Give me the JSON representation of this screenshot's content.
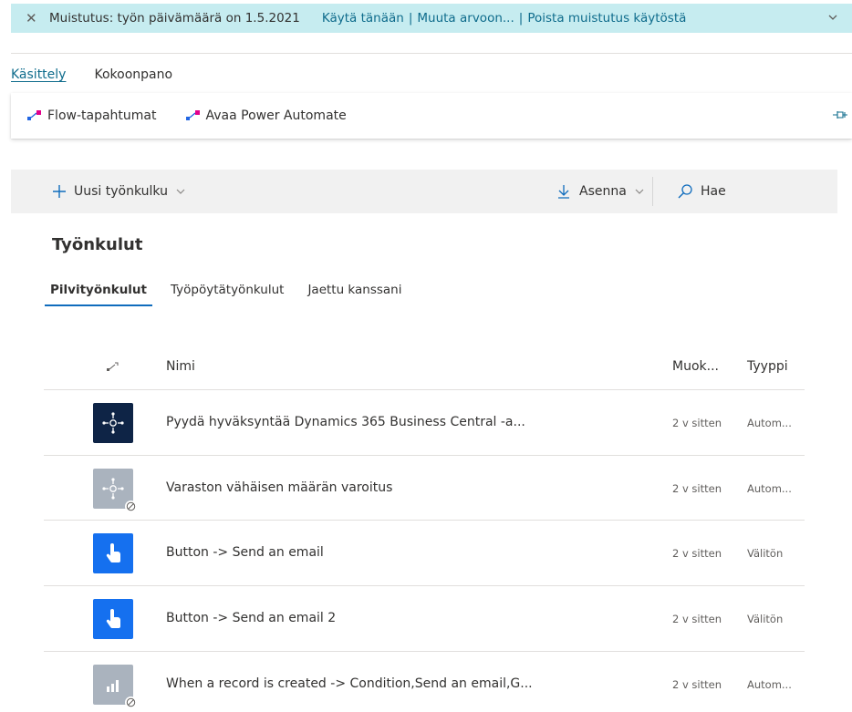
{
  "banner": {
    "message": "Muistutus: työn päivämäärä on 1.5.2021",
    "action_today": "Käytä tänään",
    "action_change": "Muuta arvoon...",
    "action_disable": "Poista muistutus käytöstä",
    "separator": "|"
  },
  "menu_tabs": [
    {
      "label": "Käsittely",
      "active": true
    },
    {
      "label": "Kokoonpano",
      "active": false
    }
  ],
  "action_bar": {
    "flow_events": "Flow-tapahtumat",
    "open_power_automate": "Avaa Power Automate"
  },
  "command_bar": {
    "new_flow": "Uusi työnkulku",
    "install": "Asenna",
    "search_placeholder": "Hae"
  },
  "section_title": "Työnkulut",
  "flow_tabs": [
    {
      "label": "Pilvityönkulut",
      "active": true
    },
    {
      "label": "Työpöytätyönkulut",
      "active": false
    },
    {
      "label": "Jaettu kanssani",
      "active": false
    }
  ],
  "table": {
    "columns": {
      "name": "Nimi",
      "modified": "Muok...",
      "type": "Tyyppi"
    },
    "rows": [
      {
        "name": "Pyydä hyväksyntää Dynamics 365 Business Central -a...",
        "modified": "2 v sitten",
        "type": "Autom...",
        "icon": "network-icon",
        "icon_style": "dark",
        "disabled": false
      },
      {
        "name": "Varaston vähäisen määrän varoitus",
        "modified": "2 v sitten",
        "type": "Autom...",
        "icon": "network-icon",
        "icon_style": "grey",
        "disabled": true
      },
      {
        "name": "Button -> Send an email",
        "modified": "2 v sitten",
        "type": "Välitön",
        "icon": "touch-icon",
        "icon_style": "blue",
        "disabled": false
      },
      {
        "name": "Button -> Send an email 2",
        "modified": "2 v sitten",
        "type": "Välitön",
        "icon": "touch-icon",
        "icon_style": "blue",
        "disabled": false
      },
      {
        "name": "When a record is created -> Condition,Send an email,G...",
        "modified": "2 v sitten",
        "type": "Autom...",
        "icon": "chart-icon",
        "icon_style": "grey",
        "disabled": true
      }
    ]
  },
  "colors": {
    "banner_bg": "#c6ecf0",
    "link": "#0f6c8c",
    "flow_icon_dark": "#0e2446",
    "flow_icon_blue": "#1570ef",
    "flow_icon_disabled": "#aab3be"
  }
}
